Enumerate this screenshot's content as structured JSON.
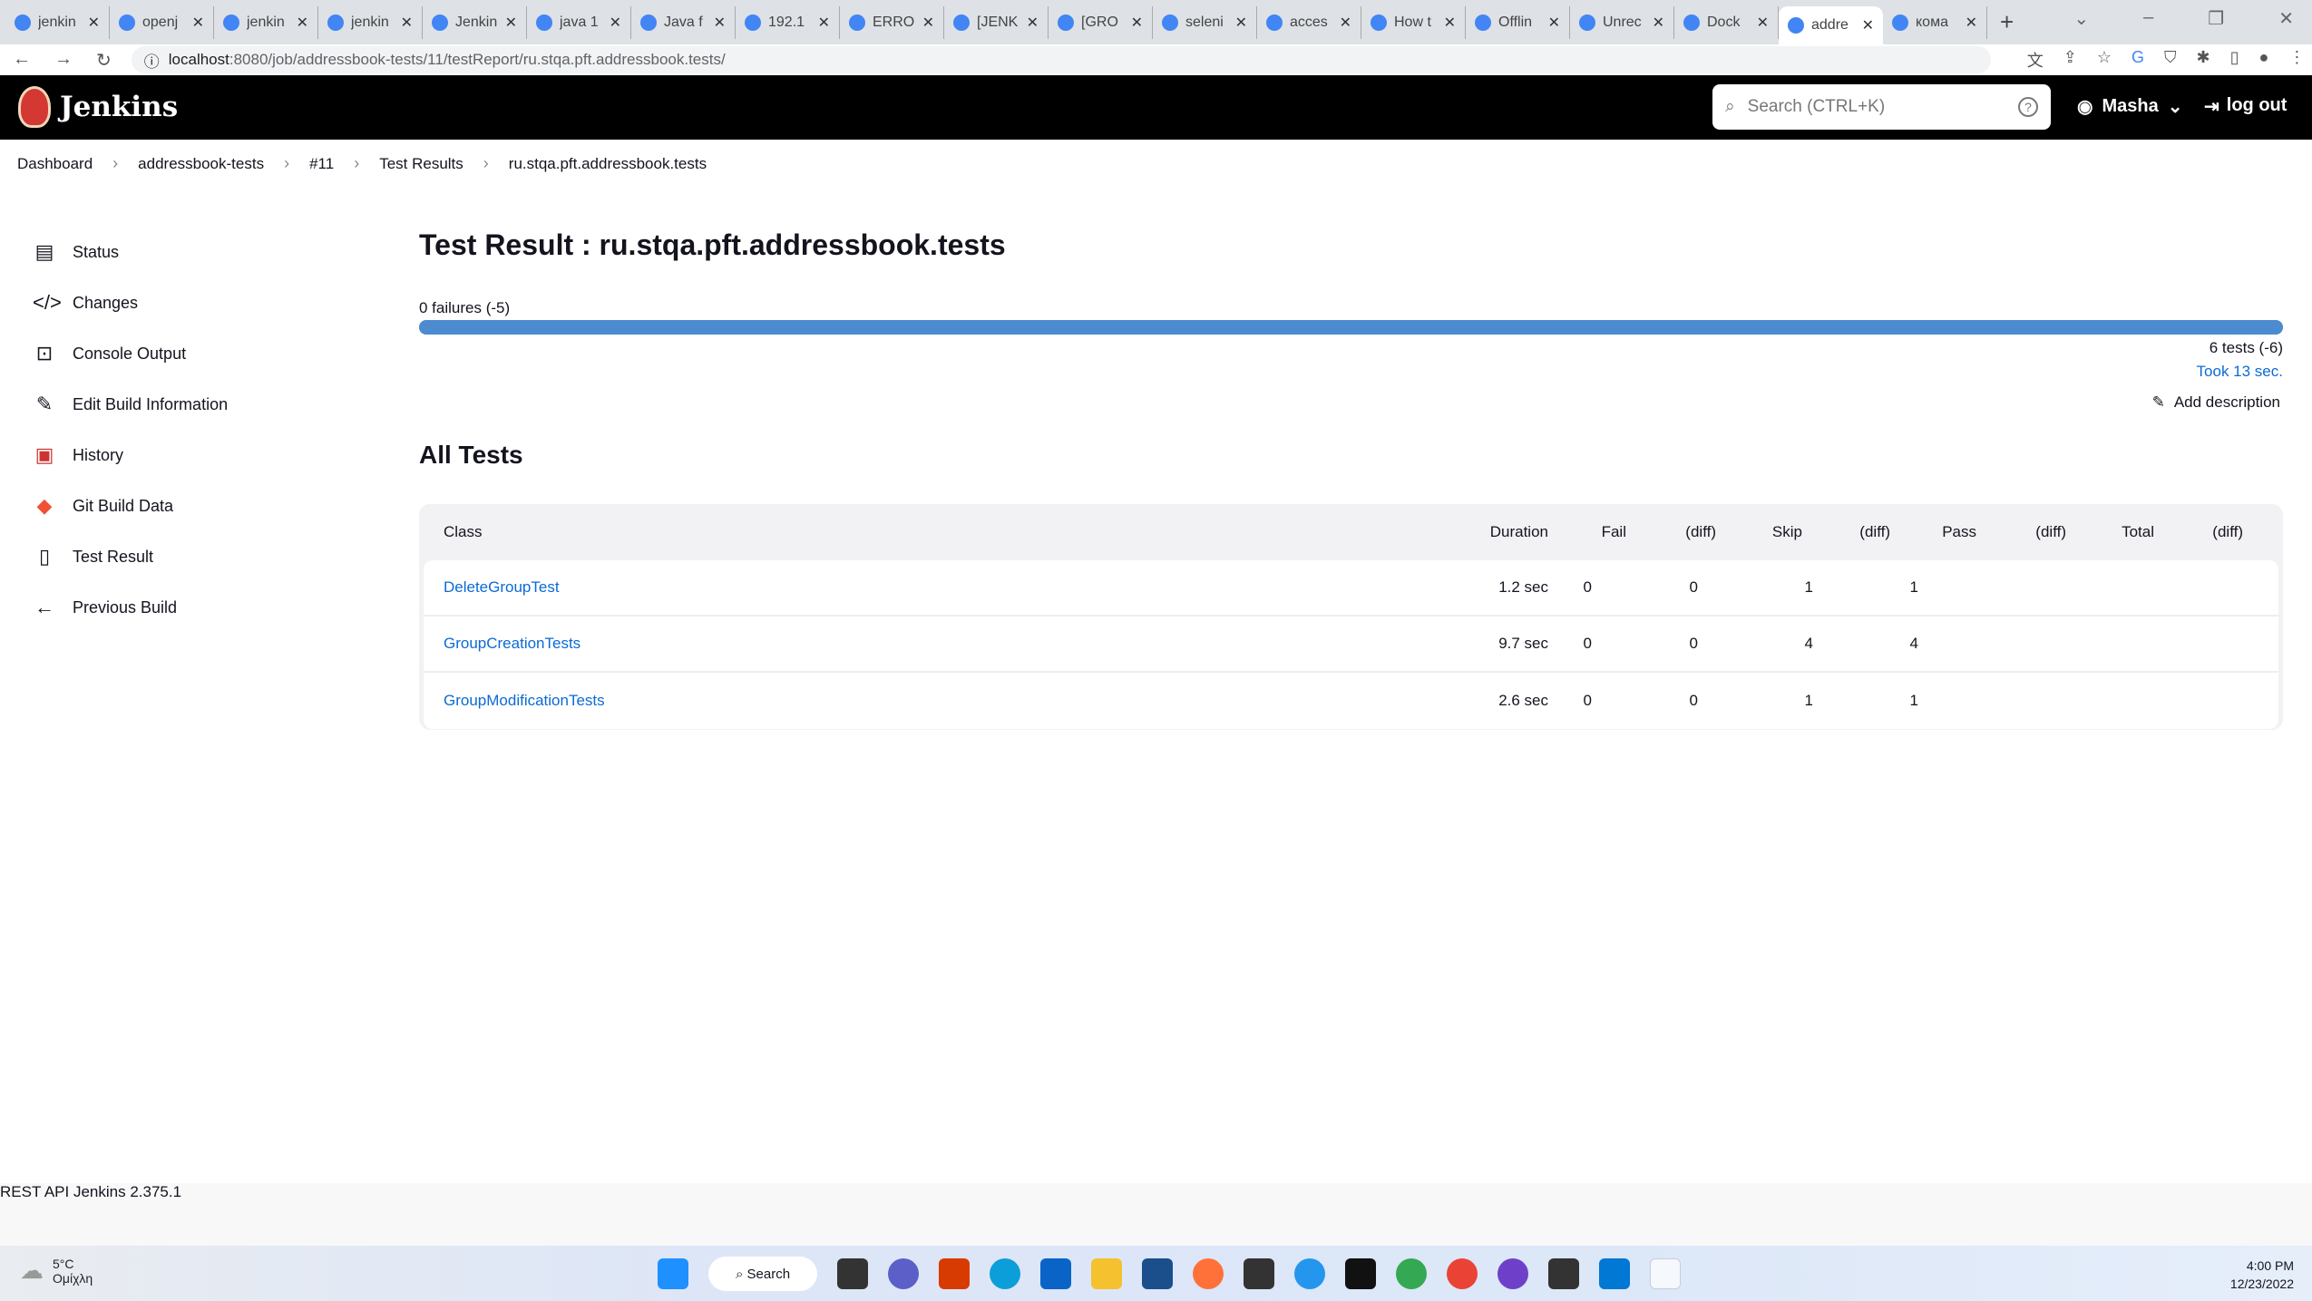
{
  "browser": {
    "tabs": [
      "jenkin",
      "openj",
      "jenkin",
      "jenkin",
      "Jenkin",
      "java 1",
      "Java f",
      "192.1",
      "ERRO",
      "[JENK",
      "[GRO",
      "seleni",
      "acces",
      "How t",
      "Offlin",
      "Unrec",
      "Dock",
      "addre",
      "кома"
    ],
    "active_tab": 17,
    "url_host": "localhost",
    "url_path": ":8080/job/addressbook-tests/11/testReport/ru.stqa.pft.addressbook.tests/"
  },
  "header": {
    "brand": "Jenkins",
    "search_placeholder": "Search (CTRL+K)",
    "user": "Masha",
    "logout": "log out"
  },
  "breadcrumbs": [
    "Dashboard",
    "addressbook-tests",
    "#11",
    "Test Results",
    "ru.stqa.pft.addressbook.tests"
  ],
  "sidebar": {
    "items": [
      {
        "label": "Status",
        "icon": "document-icon"
      },
      {
        "label": "Changes",
        "icon": "code-icon"
      },
      {
        "label": "Console Output",
        "icon": "terminal-icon"
      },
      {
        "label": "Edit Build Information",
        "icon": "edit-icon"
      },
      {
        "label": "History",
        "icon": "history-icon"
      },
      {
        "label": "Git Build Data",
        "icon": "git-icon"
      },
      {
        "label": "Test Result",
        "icon": "clipboard-icon"
      },
      {
        "label": "Previous Build",
        "icon": "arrow-left-icon"
      }
    ]
  },
  "main": {
    "title": "Test Result : ru.stqa.pft.addressbook.tests",
    "failures": "0 failures (-5)",
    "pass_fraction": 1.0,
    "tests": "6 tests (-6)",
    "took": "Took 13 sec.",
    "add_description": "Add description",
    "all_tests": "All Tests",
    "columns": [
      "Class",
      "Duration",
      "Fail",
      "(diff)",
      "Skip",
      "(diff)",
      "Pass",
      "(diff)",
      "Total",
      "(diff)"
    ],
    "rows": [
      {
        "class": "DeleteGroupTest",
        "duration": "1.2 sec",
        "fail": "0",
        "fail_diff": "",
        "skip": "0",
        "skip_diff": "",
        "pass": "1",
        "pass_diff": "",
        "total": "1",
        "total_diff": ""
      },
      {
        "class": "GroupCreationTests",
        "duration": "9.7 sec",
        "fail": "0",
        "fail_diff": "",
        "skip": "0",
        "skip_diff": "",
        "pass": "4",
        "pass_diff": "",
        "total": "4",
        "total_diff": ""
      },
      {
        "class": "GroupModificationTests",
        "duration": "2.6 sec",
        "fail": "0",
        "fail_diff": "",
        "skip": "0",
        "skip_diff": "",
        "pass": "1",
        "pass_diff": "",
        "total": "1",
        "total_diff": ""
      }
    ],
    "colors": {
      "bar": "#4c8bd0",
      "link": "#0b6ad6"
    }
  },
  "footer": {
    "rest_api": "REST API",
    "version": "Jenkins 2.375.1"
  },
  "taskbar": {
    "temp": "5°C",
    "weather": "Ομίχλη",
    "search": "Search",
    "time": "4:00 PM",
    "date": "12/23/2022"
  }
}
